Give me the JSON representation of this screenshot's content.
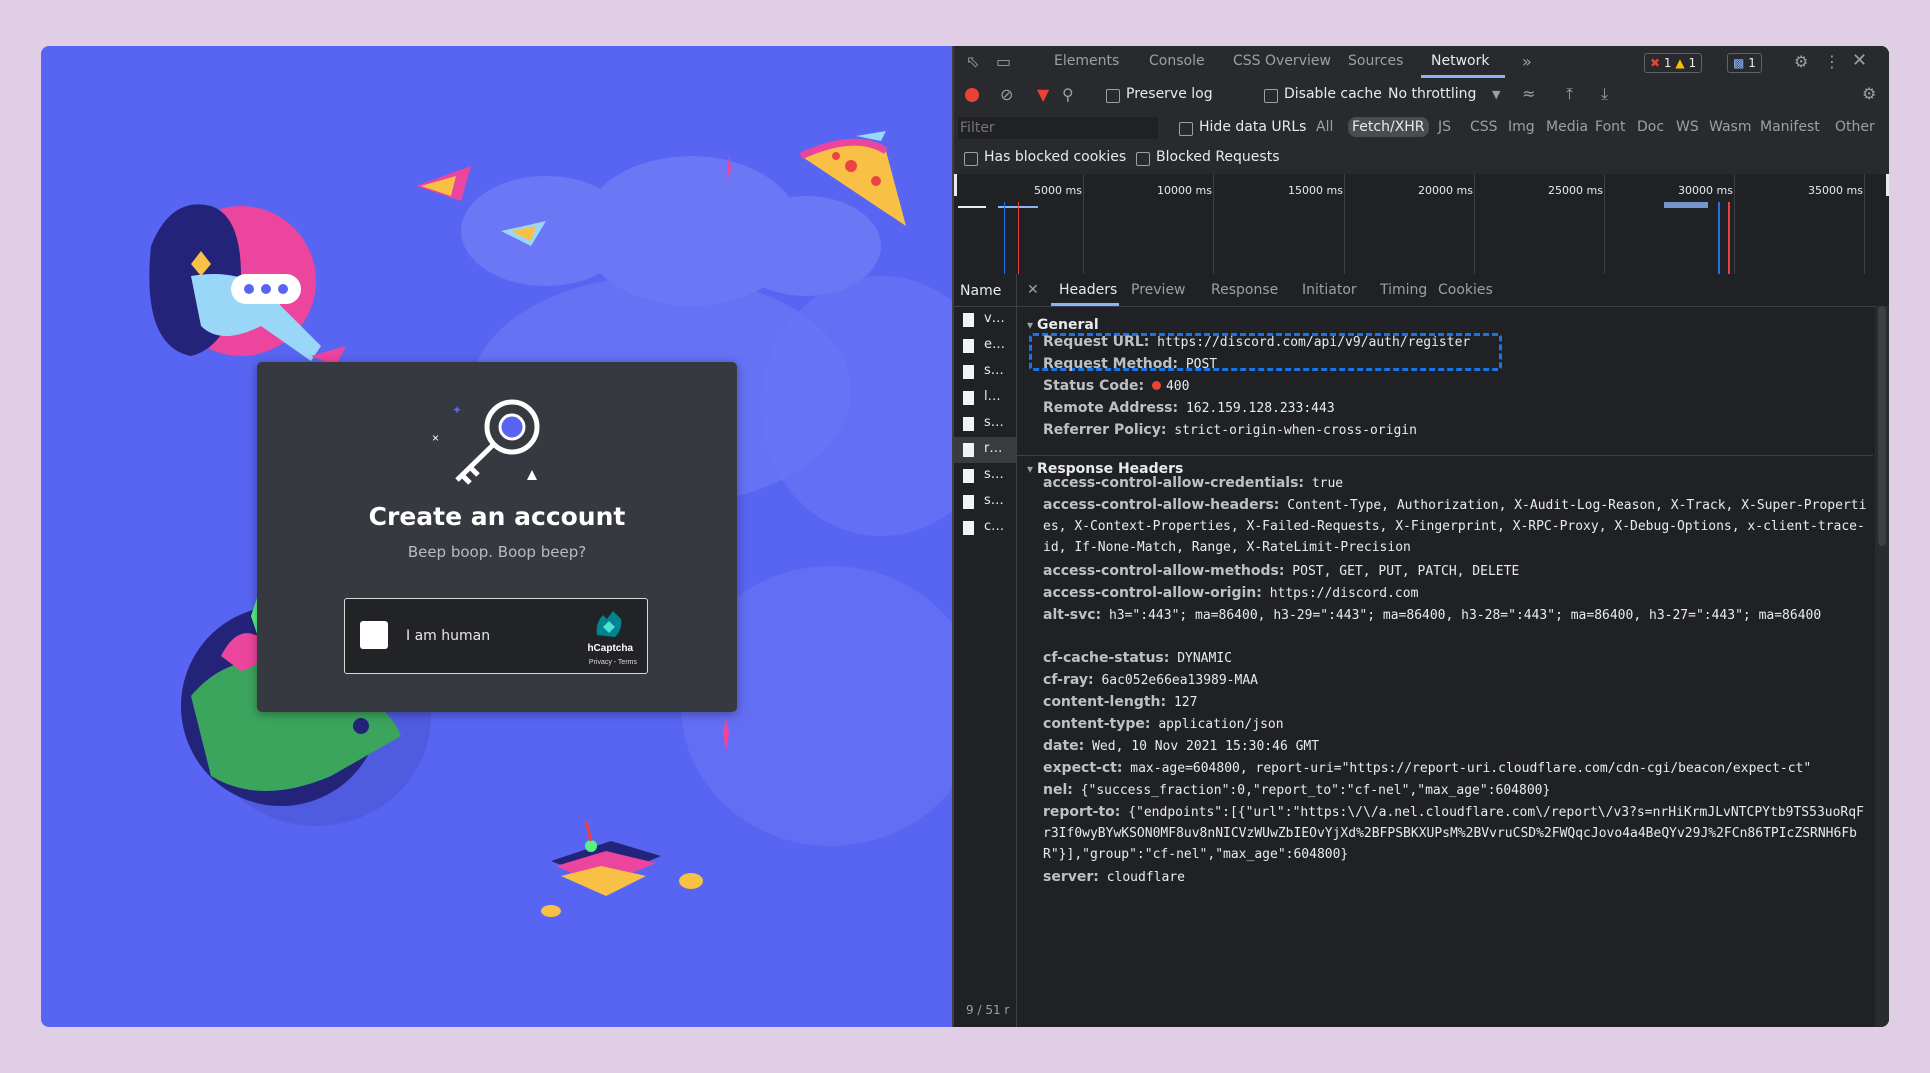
{
  "discord": {
    "modal_title": "Create an account",
    "modal_subtitle": "Beep boop. Boop beep?",
    "captcha_label": "I am human",
    "captcha_brand": "hCaptcha",
    "captcha_terms": "Privacy - Terms",
    "background_color": "#5865f2"
  },
  "devtools": {
    "tabs": [
      "Elements",
      "Console",
      "CSS Overview",
      "Sources",
      "Network"
    ],
    "active_tab": "Network",
    "badges": {
      "errors": "1",
      "warnings": "1",
      "messages": "1"
    },
    "toolbar": {
      "preserve_log": "Preserve log",
      "disable_cache": "Disable cache",
      "throttling": "No throttling"
    },
    "filter": {
      "placeholder": "Filter",
      "hide_data_urls": "Hide data URLs",
      "types": [
        "All",
        "Fetch/XHR",
        "JS",
        "CSS",
        "Img",
        "Media",
        "Font",
        "Doc",
        "WS",
        "Wasm",
        "Manifest",
        "Other"
      ],
      "active_type": "Fetch/XHR",
      "has_blocked_cookies": "Has blocked cookies",
      "blocked_requests": "Blocked Requests"
    },
    "timeline_ticks": [
      "5000 ms",
      "10000 ms",
      "15000 ms",
      "20000 ms",
      "25000 ms",
      "30000 ms",
      "35000 ms"
    ],
    "name_header": "Name",
    "requests": [
      "v…",
      "e…",
      "s…",
      "l…",
      "s…",
      "r…",
      "s…",
      "s…",
      "c…"
    ],
    "selected_request": 5,
    "footer": "9 / 51 r",
    "detail_tabs": [
      "Headers",
      "Preview",
      "Response",
      "Initiator",
      "Timing",
      "Cookies"
    ],
    "active_detail_tab": "Headers",
    "general_title": "General",
    "general": [
      {
        "k": "Request URL:",
        "v": "https://discord.com/api/v9/auth/register"
      },
      {
        "k": "Request Method:",
        "v": "POST"
      },
      {
        "k": "Status Code:",
        "v": "400"
      },
      {
        "k": "Remote Address:",
        "v": "162.159.128.233:443"
      },
      {
        "k": "Referrer Policy:",
        "v": "strict-origin-when-cross-origin"
      }
    ],
    "response_title": "Response Headers",
    "response": [
      {
        "k": "access-control-allow-credentials:",
        "v": "true"
      },
      {
        "k": "access-control-allow-headers:",
        "v": "Content-Type, Authorization, X-Audit-Log-Reason, X-Track, X-Super-Properties, X-Context-Properties, X-Failed-Requests, X-Fingerprint, X-RPC-Proxy, X-Debug-Options, x-client-trace-id, If-None-Match, Range, X-RateLimit-Precision"
      },
      {
        "k": "access-control-allow-methods:",
        "v": "POST, GET, PUT, PATCH, DELETE"
      },
      {
        "k": "access-control-allow-origin:",
        "v": "https://discord.com"
      },
      {
        "k": "alt-svc:",
        "v": "h3=\":443\"; ma=86400, h3-29=\":443\"; ma=86400, h3-28=\":443\"; ma=86400, h3-27=\":443\"; ma=86400"
      },
      {
        "k": "cf-cache-status:",
        "v": "DYNAMIC"
      },
      {
        "k": "cf-ray:",
        "v": "6ac052e66ea13989-MAA"
      },
      {
        "k": "content-length:",
        "v": "127"
      },
      {
        "k": "content-type:",
        "v": "application/json"
      },
      {
        "k": "date:",
        "v": "Wed, 10 Nov 2021 15:30:46 GMT"
      },
      {
        "k": "expect-ct:",
        "v": "max-age=604800, report-uri=\"https://report-uri.cloudflare.com/cdn-cgi/beacon/expect-ct\""
      },
      {
        "k": "nel:",
        "v": "{\"success_fraction\":0,\"report_to\":\"cf-nel\",\"max_age\":604800}"
      },
      {
        "k": "report-to:",
        "v": "{\"endpoints\":[{\"url\":\"https:\\/\\/a.nel.cloudflare.com\\/report\\/v3?s=nrHiKrmJLvNTCPYtb9TS53uoRqFr3If0wyBYwKSON0MF8uv8nNICVzWUwZbIEOvYjXd%2BFPSBKXUPsM%2BVvruCSD%2FWQqcJovo4a4BeQYv29J%2FCn86TPIcZSRNH6FbR\"}],\"group\":\"cf-nel\",\"max_age\":604800}"
      },
      {
        "k": "server:",
        "v": "cloudflare"
      }
    ],
    "colors": {
      "highlight": "#1a73e8",
      "status_error": "#ea4335",
      "accent": "#8ab4f8"
    }
  }
}
